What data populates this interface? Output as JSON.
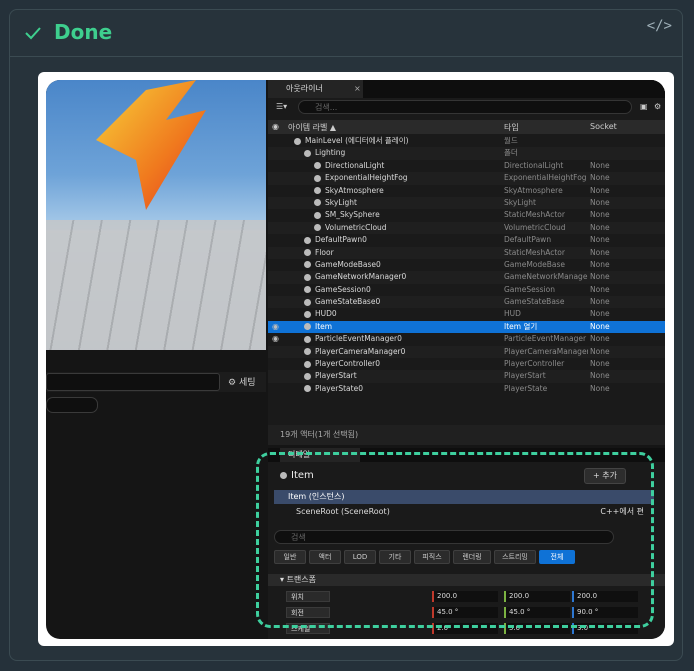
{
  "header": {
    "status": "Done",
    "code_icon": "</>"
  },
  "left_panel": {
    "settings_label": "세팅"
  },
  "outliner": {
    "tab": "아웃라이너",
    "tab_close": "×",
    "search_placeholder": "검색...",
    "columns": {
      "label": "아이템 라벨 ▲",
      "type": "타입",
      "socket": "Socket"
    },
    "rows": [
      {
        "name": "MainLevel (에디터에서 플레이)",
        "type": "월드",
        "socket": "",
        "indent": 26
      },
      {
        "name": "Lighting",
        "type": "폴더",
        "socket": "",
        "indent": 36
      },
      {
        "name": "DirectionalLight",
        "type": "DirectionalLight",
        "socket": "None",
        "indent": 46
      },
      {
        "name": "ExponentialHeightFog",
        "type": "ExponentialHeightFog",
        "socket": "None",
        "indent": 46
      },
      {
        "name": "SkyAtmosphere",
        "type": "SkyAtmosphere",
        "socket": "None",
        "indent": 46
      },
      {
        "name": "SkyLight",
        "type": "SkyLight",
        "socket": "None",
        "indent": 46
      },
      {
        "name": "SM_SkySphere",
        "type": "StaticMeshActor",
        "socket": "None",
        "indent": 46
      },
      {
        "name": "VolumetricCloud",
        "type": "VolumetricCloud",
        "socket": "None",
        "indent": 46
      },
      {
        "name": "DefaultPawn0",
        "type": "DefaultPawn",
        "socket": "None",
        "indent": 36
      },
      {
        "name": "Floor",
        "type": "StaticMeshActor",
        "socket": "None",
        "indent": 36
      },
      {
        "name": "GameModeBase0",
        "type": "GameModeBase",
        "socket": "None",
        "indent": 36
      },
      {
        "name": "GameNetworkManager0",
        "type": "GameNetworkManager",
        "socket": "None",
        "indent": 36
      },
      {
        "name": "GameSession0",
        "type": "GameSession",
        "socket": "None",
        "indent": 36
      },
      {
        "name": "GameStateBase0",
        "type": "GameStateBase",
        "socket": "None",
        "indent": 36
      },
      {
        "name": "HUD0",
        "type": "HUD",
        "socket": "None",
        "indent": 36
      },
      {
        "name": "Item",
        "type": "Item 열기",
        "socket": "None",
        "indent": 36,
        "selected": true
      },
      {
        "name": "ParticleEventManager0",
        "type": "ParticleEventManager",
        "socket": "None",
        "indent": 36
      },
      {
        "name": "PlayerCameraManager0",
        "type": "PlayerCameraManager",
        "socket": "None",
        "indent": 36
      },
      {
        "name": "PlayerController0",
        "type": "PlayerController",
        "socket": "None",
        "indent": 36
      },
      {
        "name": "PlayerStart",
        "type": "PlayerStart",
        "socket": "None",
        "indent": 36
      },
      {
        "name": "PlayerState0",
        "type": "PlayerState",
        "socket": "None",
        "indent": 36
      }
    ],
    "status": "19개 액터(1개 선택됨)"
  },
  "details": {
    "tab": "디테일",
    "title": "Item",
    "add_button": "+ 추가",
    "component_root": "Item (인스턴스)",
    "component_child": "SceneRoot (SceneRoot)",
    "cpp_label": "C++에서 편",
    "search_placeholder": "검색",
    "filters": [
      "일반",
      "액터",
      "LOD",
      "기타",
      "피직스",
      "렌더링",
      "스트리밍",
      "전체"
    ],
    "section": "트랜스폼",
    "props": [
      {
        "label": "위치",
        "x": "200.0",
        "y": "200.0",
        "z": "200.0"
      },
      {
        "label": "회전",
        "x": "45.0 °",
        "y": "45.0 °",
        "z": "90.0 °"
      },
      {
        "label": "스케일",
        "x": "2.0",
        "y": "5.0",
        "z": "3.0"
      }
    ]
  },
  "colors": {
    "accent": "#3ecf8e",
    "selection": "#0f72d6",
    "x_axis": "#c0392b",
    "y_axis": "#7cb342",
    "z_axis": "#2e78d2"
  }
}
